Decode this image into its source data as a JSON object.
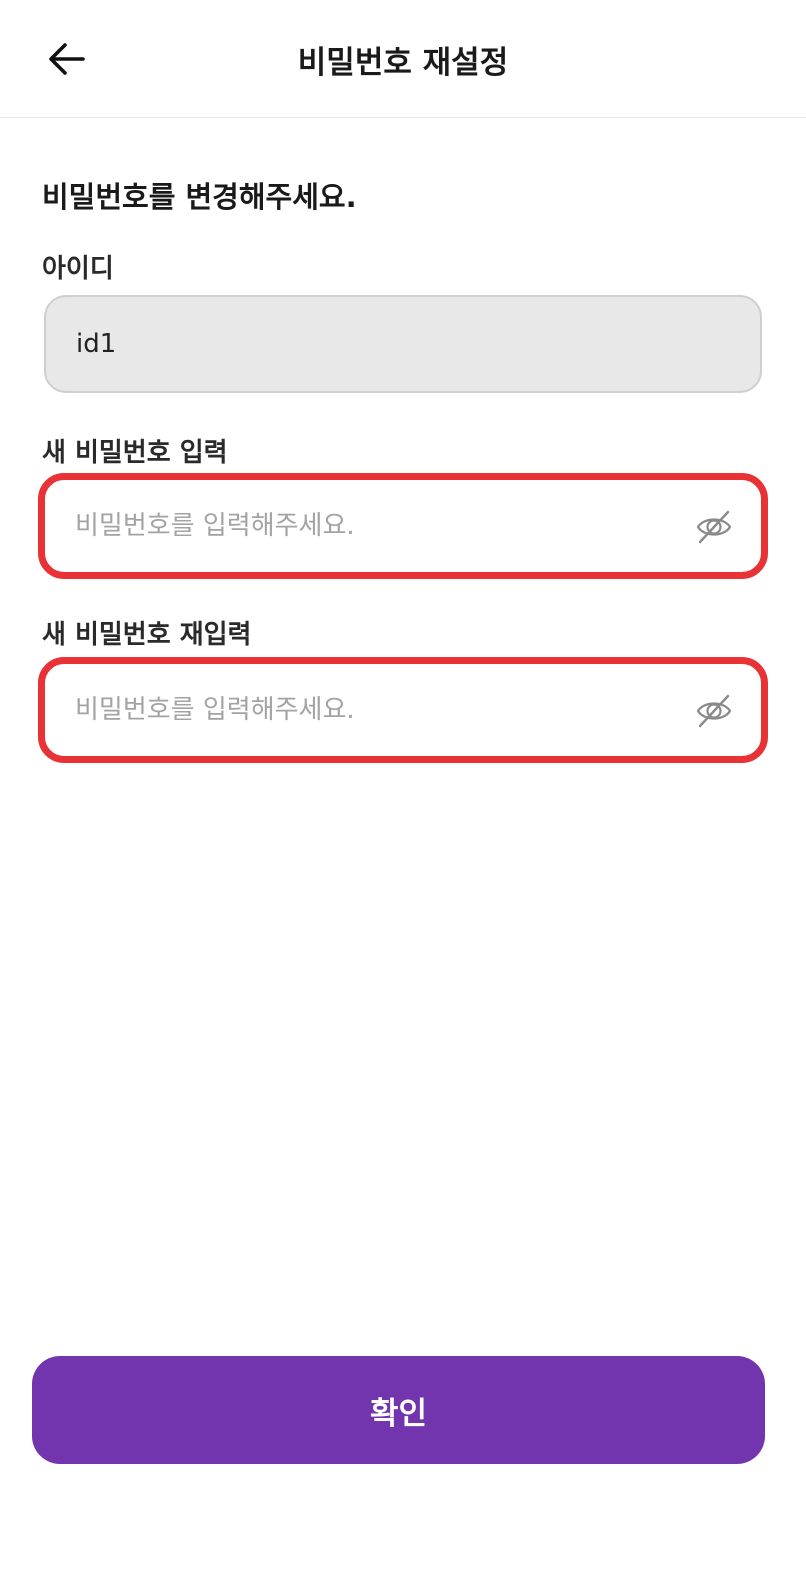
{
  "header": {
    "title": "비밀번호 재설정",
    "back_icon": "arrow-left-icon"
  },
  "form": {
    "heading": "비밀번호를 변경해주세요.",
    "id_field": {
      "label": "아이디",
      "value": "id1"
    },
    "new_password": {
      "label": "새 비밀번호 입력",
      "placeholder": "비밀번호를 입력해주세요.",
      "value": "",
      "icon": "eye-off-icon"
    },
    "confirm_password": {
      "label": "새 비밀번호 재입력",
      "placeholder": "비밀번호를 입력해주세요.",
      "value": "",
      "icon": "eye-off-icon"
    }
  },
  "actions": {
    "confirm_label": "확인"
  },
  "colors": {
    "primary": "#7335ad",
    "error_border": "#e83235",
    "disabled_field_bg": "#e8e8e8",
    "placeholder": "#a3a3a3"
  }
}
